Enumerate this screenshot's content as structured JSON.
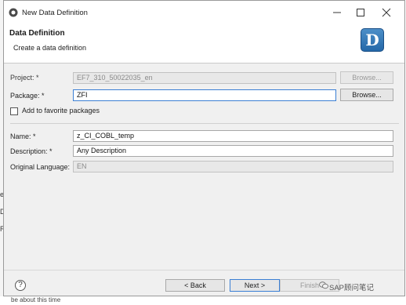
{
  "window": {
    "title": "New Data Definition",
    "minimize_icon": "minimize-icon",
    "maximize_icon": "maximize-icon",
    "close_icon": "close-icon"
  },
  "banner": {
    "title": "Data Definition",
    "subtitle": "Create a data definition",
    "logo_letter": "D"
  },
  "form": {
    "project_label": "Project: *",
    "project_value": "EF7_310_50022035_en",
    "project_browse": "Browse...",
    "package_label": "Package: *",
    "package_value": "ZFI",
    "package_browse": "Browse...",
    "add_favorite_label": "Add to favorite packages",
    "add_favorite_checked": false,
    "name_label": "Name: *",
    "name_value": "z_CI_COBL_temp",
    "description_label": "Description: *",
    "description_value": "Any Description",
    "language_label": "Original Language:",
    "language_value": "EN"
  },
  "footer": {
    "help": "?",
    "back": "< Back",
    "next": "Next >",
    "finish": "Finish"
  },
  "watermark": "SAP顾问笔记",
  "background": {
    "letters": [
      "e",
      "D",
      "R"
    ],
    "bottom_text": "be about this time"
  },
  "colors": {
    "accent": "#3b7fd4",
    "logo": "#2468a8"
  }
}
